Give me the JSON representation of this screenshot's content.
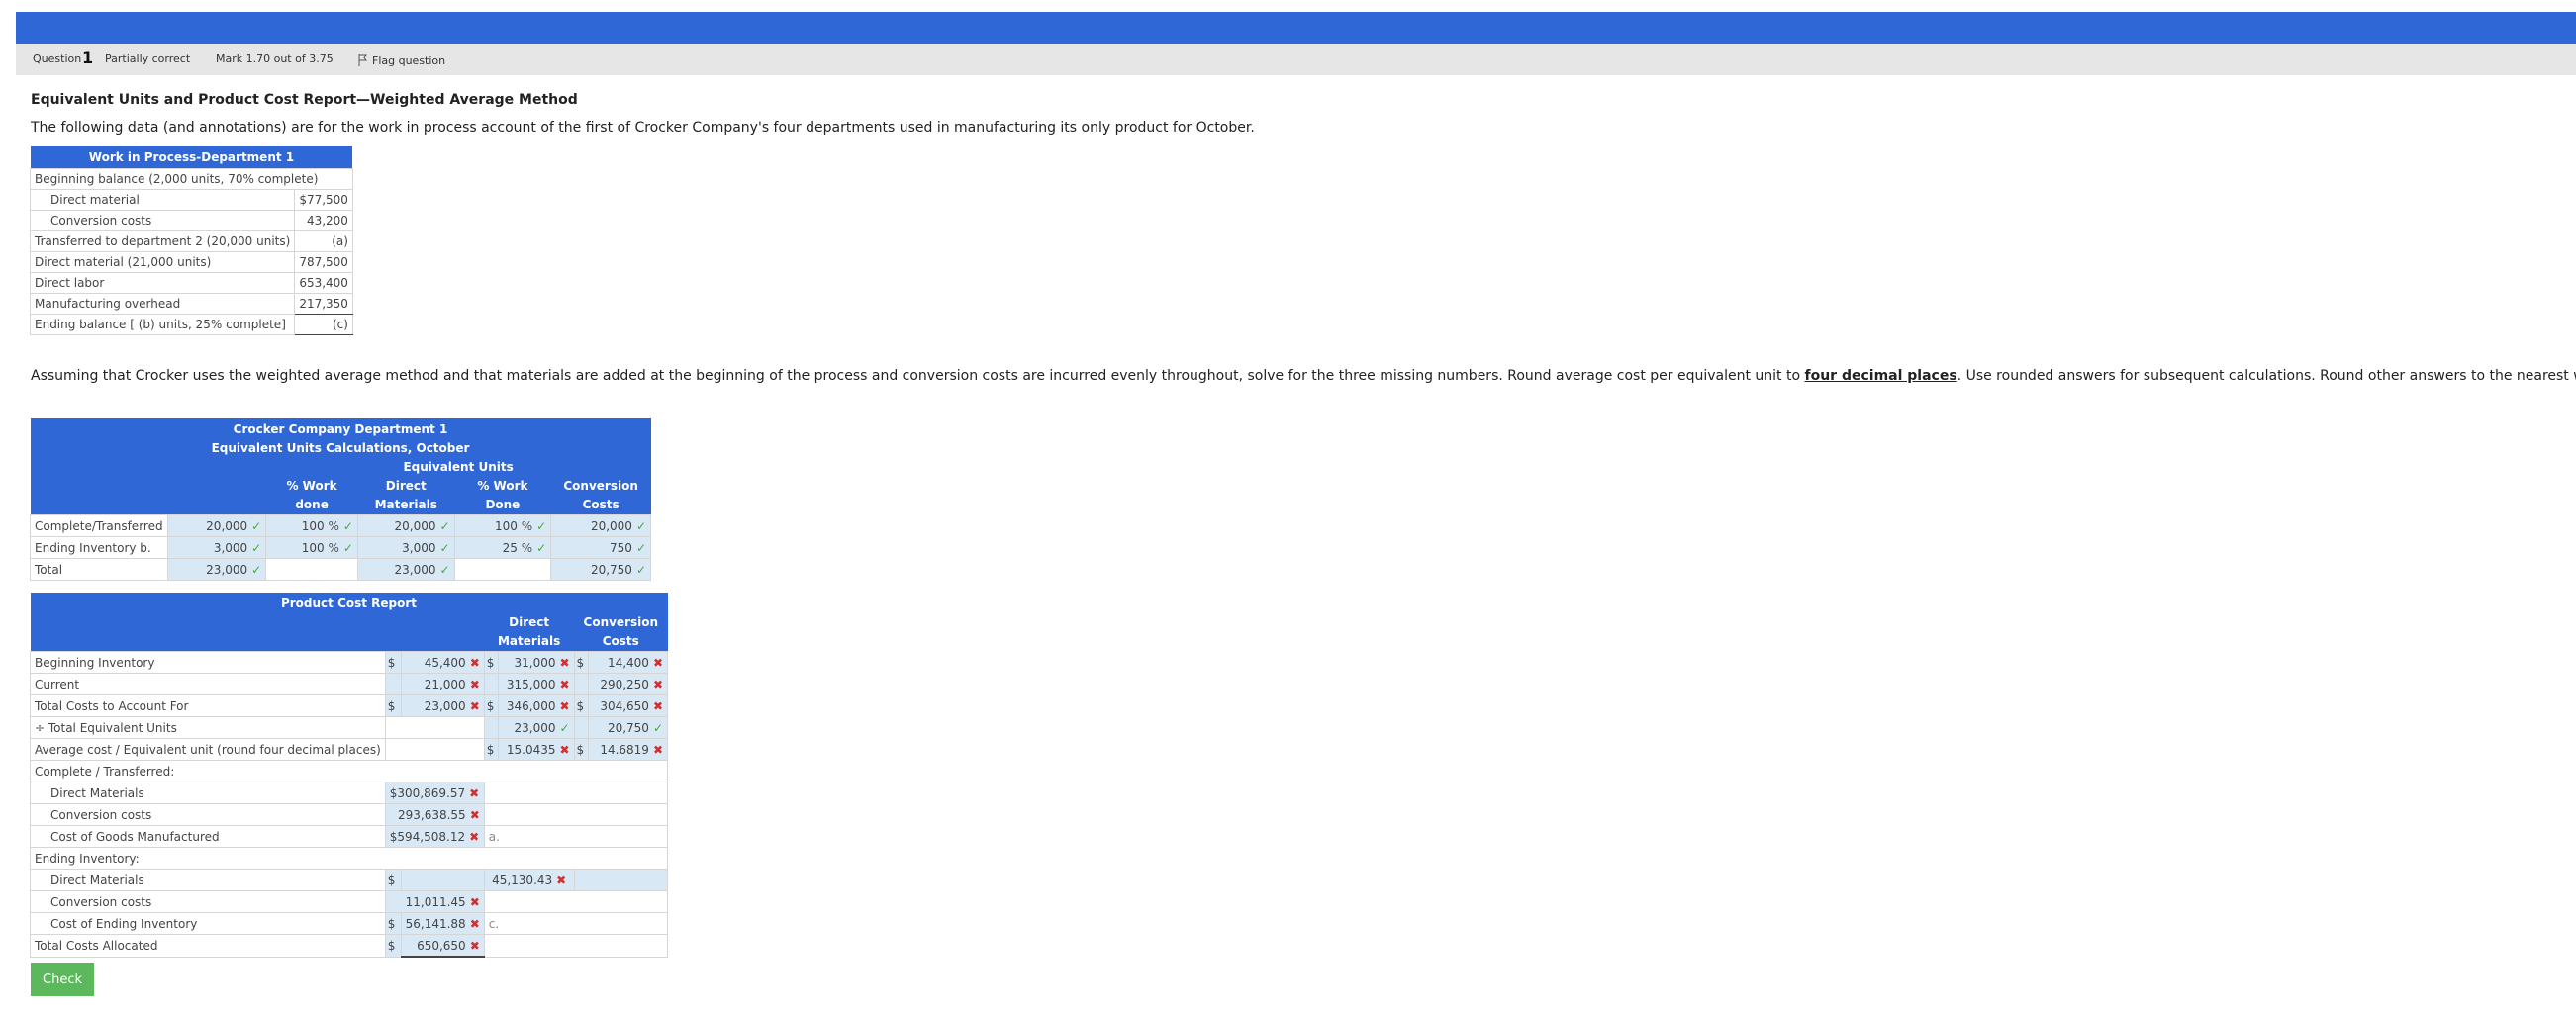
{
  "info": {
    "question_label": "Question",
    "question_number": "1",
    "status": "Partially correct",
    "mark": "Mark 1.70 out of 3.75",
    "flag": "Flag question"
  },
  "heading": "Equivalent Units and Product Cost Report—Weighted Average Method",
  "intro": "The following data (and annotations) are for the work in process account of the first of Crocker Company's four departments used in manufacturing its only product for October.",
  "wip": {
    "title": "Work in Process-Department 1",
    "rows": [
      {
        "label": "Beginning balance (2,000 units, 70% complete)",
        "amount": ""
      },
      {
        "label": "Direct material",
        "amount": "$77,500"
      },
      {
        "label": "Conversion costs",
        "amount": "43,200"
      },
      {
        "label": "Transferred to department 2 (20,000 units)",
        "amount": "(a)"
      },
      {
        "label": "Direct material (21,000 units)",
        "amount": "787,500"
      },
      {
        "label": "Direct labor",
        "amount": "653,400"
      },
      {
        "label": "Manufacturing overhead",
        "amount": "217,350"
      },
      {
        "label": "Ending balance [ (b) units, 25% complete]",
        "amount": "(c)"
      }
    ]
  },
  "assume": {
    "text_before": "Assuming that Crocker uses the weighted average method and that materials are added at the beginning of the process and conversion costs are incurred evenly throughout, solve for the three missing numbers. Round average cost per equivalent unit to ",
    "emphasis": "four decimal places",
    "text_after": ". Use rounded answers for subsequent calculations. Round other answers to the nearest whole number."
  },
  "equ": {
    "title1": "Crocker Company Department 1",
    "title2": "Equivalent Units Calculations, October",
    "title3": "Equivalent Units",
    "h_pct1a": "% Work",
    "h_pct1b": "done",
    "h_dm_a": "Direct",
    "h_dm_b": "Materials",
    "h_pct2a": "% Work",
    "h_pct2b": "Done",
    "h_cc_a": "Conversion",
    "h_cc_b": "Costs",
    "pct_sign": "%",
    "rows": [
      {
        "label": "Complete/Transferred",
        "units": "20,000",
        "pct1": "100",
        "dm": "20,000",
        "pct2": "100",
        "cc": "20,000"
      },
      {
        "label": "Ending Inventory b.",
        "units": "3,000",
        "pct1": "100",
        "dm": "3,000",
        "pct2": "25",
        "cc": "750"
      },
      {
        "label": "Total",
        "units": "23,000",
        "dm": "23,000",
        "cc": "20,750"
      }
    ]
  },
  "pcr": {
    "title": "Product Cost Report",
    "h_dm_a": "Direct",
    "h_dm_b": "Materials",
    "h_cc_a": "Conversion",
    "h_cc_b": "Costs",
    "dollar": "$",
    "rows": {
      "beg": {
        "label": "Beginning Inventory",
        "total": "45,400",
        "dm": "31,000",
        "cc": "14,400"
      },
      "cur": {
        "label": "Current",
        "total": "21,000",
        "dm": "315,000",
        "cc": "290,250"
      },
      "tca": {
        "label": "Total Costs to Account For",
        "total": "23,000",
        "dm": "346,000",
        "cc": "304,650"
      },
      "teu": {
        "label": "÷ Total Equivalent Units",
        "dm": "23,000",
        "cc": "20,750"
      },
      "avg": {
        "label": "Average cost / Equivalent unit (round four decimal places)",
        "dm": "15.0435",
        "cc": "14.6819"
      },
      "ct_head": {
        "label": "Complete / Transferred:"
      },
      "ct_dm": {
        "label": "Direct Materials",
        "total": "300,869.57"
      },
      "ct_cc": {
        "label": "Conversion costs",
        "total": "293,638.55"
      },
      "ct_cgm": {
        "label": "Cost of Goods Manufactured",
        "total": "594,508.12",
        "note": "a."
      },
      "ei_head": {
        "label": "Ending Inventory:"
      },
      "ei_dm": {
        "label": "Direct Materials",
        "dm": "45,130.43"
      },
      "ei_cc": {
        "label": "Conversion costs",
        "total": "11,011.45"
      },
      "ei_cost": {
        "label": "Cost of Ending Inventory",
        "total": "56,141.88",
        "note": "c."
      },
      "tcal": {
        "label": "Total Costs Allocated",
        "total": "650,650"
      }
    }
  },
  "check_label": "Check"
}
